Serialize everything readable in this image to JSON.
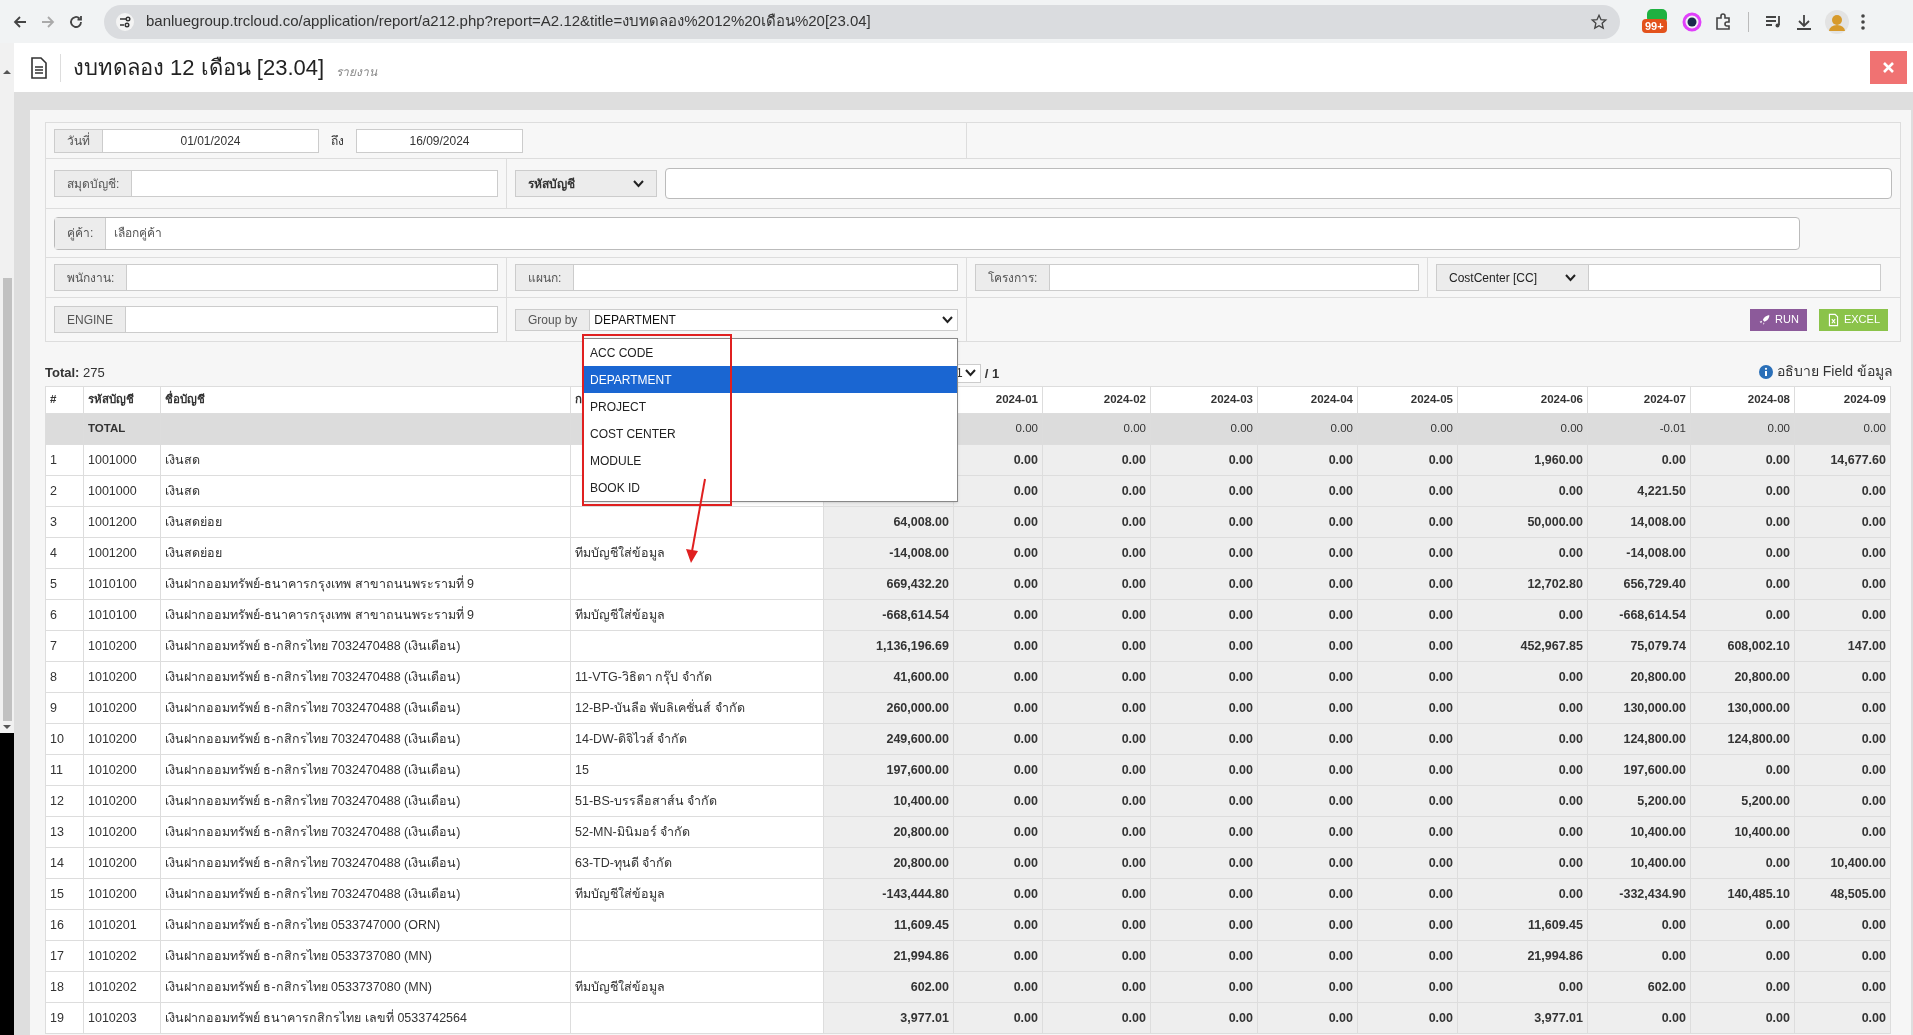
{
  "browser": {
    "url": "banluegroup.trcloud.co/application/report/a212.php?report=A2.12&title=งบทดลอง%2012%20เดือน%20[23.04]",
    "badge": "99+"
  },
  "header": {
    "title": "งบทดลอง 12 เดือน [23.04]",
    "subtitle": "รายงาน"
  },
  "filters": {
    "date": {
      "label": "วันที่",
      "from": "01/01/2024",
      "to_label": "ถึง",
      "to": "16/09/2024"
    },
    "book": {
      "label": "สมุดบัญชี:"
    },
    "account_select": {
      "value": "รหัสบัญชี"
    },
    "vendor": {
      "label": "คู่ค้า:",
      "placeholder": "เลือกคู่ค้า"
    },
    "employee": {
      "label": "พนักงาน:"
    },
    "department": {
      "label": "แผนก:"
    },
    "project": {
      "label": "โครงการ:"
    },
    "cost_center": {
      "value": "CostCenter [CC]"
    },
    "engine": {
      "label": "ENGINE"
    },
    "group_by": {
      "label": "Group by",
      "value": "DEPARTMENT",
      "expanded": true,
      "options": [
        {
          "label": "ACC CODE",
          "selected": false
        },
        {
          "label": "DEPARTMENT",
          "selected": true
        },
        {
          "label": "PROJECT",
          "selected": false
        },
        {
          "label": "COST CENTER",
          "selected": false
        },
        {
          "label": "MODULE",
          "selected": false
        },
        {
          "label": "BOOK ID",
          "selected": false
        }
      ]
    }
  },
  "buttons": [
    {
      "kind": "run",
      "label": "RUN"
    },
    {
      "kind": "excel",
      "label": "EXCEL"
    }
  ],
  "summary": {
    "total_label": "Total:",
    "total": "275",
    "page": "1",
    "pages": "/ 1",
    "help": "อธิบาย Field ข้อมูล"
  },
  "table": {
    "columns": [
      "#",
      "รหัสบัญชี",
      "ชื่อบัญชี",
      "ก",
      null,
      "2024-01",
      "2024-02",
      "2024-03",
      "2024-04",
      "2024-05",
      "2024-06",
      "2024-07",
      "2024-08",
      "2024-09"
    ],
    "total_row": {
      "label": "TOTAL",
      "months": [
        "0.00",
        "0.00",
        "0.00",
        "0.00",
        "0.00",
        "0.00",
        "-0.01",
        "0.00",
        "0.00"
      ]
    },
    "rows": [
      {
        "no": "1",
        "code": "1001000",
        "name": "เงินสด",
        "months": [
          "0.00",
          "0.00",
          "0.00",
          "0.00",
          "0.00",
          "1,960.00",
          "0.00",
          "0.00",
          "14,677.60"
        ]
      },
      {
        "no": "2",
        "code": "1001000",
        "name": "เงินสด",
        "months": [
          "0.00",
          "0.00",
          "0.00",
          "0.00",
          "0.00",
          "0.00",
          "4,221.50",
          "0.00",
          "0.00"
        ]
      },
      {
        "no": "3",
        "code": "1001200",
        "name": "เงินสดย่อย",
        "total": "64,008.00",
        "months": [
          "0.00",
          "0.00",
          "0.00",
          "0.00",
          "0.00",
          "50,000.00",
          "14,008.00",
          "0.00",
          "0.00"
        ]
      },
      {
        "no": "4",
        "code": "1001200",
        "name": "เงินสดย่อย",
        "group": "ทีมบัญชีใส่ข้อมูล",
        "total": "-14,008.00",
        "months": [
          "0.00",
          "0.00",
          "0.00",
          "0.00",
          "0.00",
          "0.00",
          "-14,008.00",
          "0.00",
          "0.00"
        ]
      },
      {
        "no": "5",
        "code": "1010100",
        "name": "เงินฝากออมทรัพย์-ธนาคารกรุงเทพ สาขาถนนพระรามที่ 9",
        "total": "669,432.20",
        "months": [
          "0.00",
          "0.00",
          "0.00",
          "0.00",
          "0.00",
          "12,702.80",
          "656,729.40",
          "0.00",
          "0.00"
        ]
      },
      {
        "no": "6",
        "code": "1010100",
        "name": "เงินฝากออมทรัพย์-ธนาคารกรุงเทพ สาขาถนนพระรามที่ 9",
        "group": "ทีมบัญชีใส่ข้อมูล",
        "total": "-668,614.54",
        "months": [
          "0.00",
          "0.00",
          "0.00",
          "0.00",
          "0.00",
          "0.00",
          "-668,614.54",
          "0.00",
          "0.00"
        ]
      },
      {
        "no": "7",
        "code": "1010200",
        "name": "เงินฝากออมทรัพย์ ธ-กสิกรไทย 7032470488 (เงินเดือน)",
        "total": "1,136,196.69",
        "months": [
          "0.00",
          "0.00",
          "0.00",
          "0.00",
          "0.00",
          "452,967.85",
          "75,079.74",
          "608,002.10",
          "147.00"
        ]
      },
      {
        "no": "8",
        "code": "1010200",
        "name": "เงินฝากออมทรัพย์ ธ-กสิกรไทย 7032470488 (เงินเดือน)",
        "group": "11-VTG-วิธิตา กรุ๊ป จำกัด",
        "total": "41,600.00",
        "months": [
          "0.00",
          "0.00",
          "0.00",
          "0.00",
          "0.00",
          "0.00",
          "20,800.00",
          "20,800.00",
          "0.00"
        ]
      },
      {
        "no": "9",
        "code": "1010200",
        "name": "เงินฝากออมทรัพย์ ธ-กสิกรไทย 7032470488 (เงินเดือน)",
        "group": "12-BP-บันลือ พับลิเคชั่นส์ จำกัด",
        "total": "260,000.00",
        "months": [
          "0.00",
          "0.00",
          "0.00",
          "0.00",
          "0.00",
          "0.00",
          "130,000.00",
          "130,000.00",
          "0.00"
        ]
      },
      {
        "no": "10",
        "code": "1010200",
        "name": "เงินฝากออมทรัพย์ ธ-กสิกรไทย 7032470488 (เงินเดือน)",
        "group": "14-DW-ดิจิไวส์ จำกัด",
        "total": "249,600.00",
        "months": [
          "0.00",
          "0.00",
          "0.00",
          "0.00",
          "0.00",
          "0.00",
          "124,800.00",
          "124,800.00",
          "0.00"
        ]
      },
      {
        "no": "11",
        "code": "1010200",
        "name": "เงินฝากออมทรัพย์ ธ-กสิกรไทย 7032470488 (เงินเดือน)",
        "group": "15",
        "total": "197,600.00",
        "months": [
          "0.00",
          "0.00",
          "0.00",
          "0.00",
          "0.00",
          "0.00",
          "197,600.00",
          "0.00",
          "0.00"
        ]
      },
      {
        "no": "12",
        "code": "1010200",
        "name": "เงินฝากออมทรัพย์ ธ-กสิกรไทย 7032470488 (เงินเดือน)",
        "group": "51-BS-บรรลือสาส์น จำกัด",
        "total": "10,400.00",
        "months": [
          "0.00",
          "0.00",
          "0.00",
          "0.00",
          "0.00",
          "0.00",
          "5,200.00",
          "5,200.00",
          "0.00"
        ]
      },
      {
        "no": "13",
        "code": "1010200",
        "name": "เงินฝากออมทรัพย์ ธ-กสิกรไทย 7032470488 (เงินเดือน)",
        "group": "52-MN-มินิมอร์ จำกัด",
        "total": "20,800.00",
        "months": [
          "0.00",
          "0.00",
          "0.00",
          "0.00",
          "0.00",
          "0.00",
          "10,400.00",
          "10,400.00",
          "0.00"
        ]
      },
      {
        "no": "14",
        "code": "1010200",
        "name": "เงินฝากออมทรัพย์ ธ-กสิกรไทย 7032470488 (เงินเดือน)",
        "group": "63-TD-ทุนดี จำกัด",
        "total": "20,800.00",
        "months": [
          "0.00",
          "0.00",
          "0.00",
          "0.00",
          "0.00",
          "0.00",
          "10,400.00",
          "0.00",
          "10,400.00"
        ]
      },
      {
        "no": "15",
        "code": "1010200",
        "name": "เงินฝากออมทรัพย์ ธ-กสิกรไทย 7032470488 (เงินเดือน)",
        "group": "ทีมบัญชีใส่ข้อมูล",
        "total": "-143,444.80",
        "months": [
          "0.00",
          "0.00",
          "0.00",
          "0.00",
          "0.00",
          "0.00",
          "-332,434.90",
          "140,485.10",
          "48,505.00"
        ]
      },
      {
        "no": "16",
        "code": "1010201",
        "name": "เงินฝากออมทรัพย์ ธ-กสิกรไทย 0533747000 (ORN)",
        "total": "11,609.45",
        "months": [
          "0.00",
          "0.00",
          "0.00",
          "0.00",
          "0.00",
          "11,609.45",
          "0.00",
          "0.00",
          "0.00"
        ]
      },
      {
        "no": "17",
        "code": "1010202",
        "name": "เงินฝากออมทรัพย์ ธ-กสิกรไทย 0533737080 (MN)",
        "total": "21,994.86",
        "months": [
          "0.00",
          "0.00",
          "0.00",
          "0.00",
          "0.00",
          "21,994.86",
          "0.00",
          "0.00",
          "0.00"
        ]
      },
      {
        "no": "18",
        "code": "1010202",
        "name": "เงินฝากออมทรัพย์ ธ-กสิกรไทย 0533737080 (MN)",
        "group": "ทีมบัญชีใส่ข้อมูล",
        "total": "602.00",
        "months": [
          "0.00",
          "0.00",
          "0.00",
          "0.00",
          "0.00",
          "0.00",
          "602.00",
          "0.00",
          "0.00"
        ]
      },
      {
        "no": "19",
        "code": "1010203",
        "name": "เงินฝากออมทรัพย์ ธนาคารกสิกรไทย เลขที่ 0533742564",
        "total": "3,977.01",
        "months": [
          "0.00",
          "0.00",
          "0.00",
          "0.00",
          "0.00",
          "3,977.01",
          "0.00",
          "0.00",
          "0.00"
        ]
      }
    ]
  }
}
